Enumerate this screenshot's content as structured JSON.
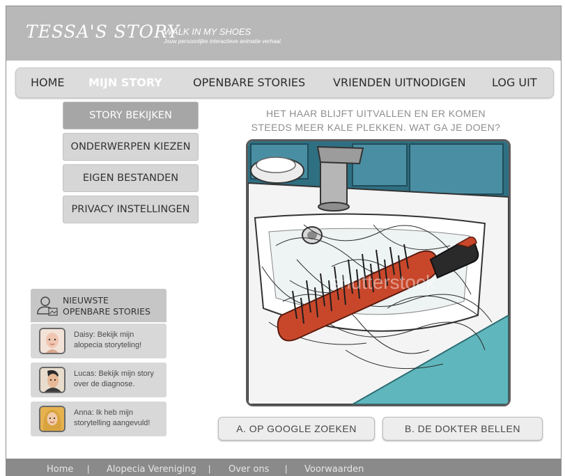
{
  "header": {
    "title": "TESSA'S STORY",
    "tagline": "WALK IN MY SHOES",
    "subtitle": "Jouw persoonlijke interactieve animatie verhaal."
  },
  "nav": {
    "items": [
      {
        "label": "HOME"
      },
      {
        "label": "MIJN STORY",
        "active": true
      },
      {
        "label": "OPENBARE STORIES"
      },
      {
        "label": "VRIENDEN UITNODIGEN"
      },
      {
        "label": "LOG UIT"
      }
    ]
  },
  "submenu": {
    "items": [
      {
        "label": "STORY BEKIJKEN",
        "active": true
      },
      {
        "label": "ONDERWERPEN KIEZEN"
      },
      {
        "label": "EIGEN BESTANDEN"
      },
      {
        "label": "PRIVACY INSTELLINGEN"
      }
    ]
  },
  "scene": {
    "question_line1": "HET HAAR BLIJFT UITVALLEN EN ER KOMEN",
    "question_line2": "STEEDS MEER KALE PLEKKEN. WAT GA JE DOEN?",
    "watermark": "shutterstock",
    "choice_a": "A. OP GOOGLE ZOEKEN",
    "choice_b": "B. DE DOKTER BELLEN"
  },
  "stories": {
    "heading_line1": "NIEUWSTE",
    "heading_line2": "OPENBARE STORIES",
    "items": [
      {
        "line1": "Daisy: Bekijk mijn",
        "line2": "alopecia storyteling!"
      },
      {
        "line1": "Lucas: Bekijk mijn story",
        "line2": "over de diagnose."
      },
      {
        "line1": "Anna: Ik heb mijn",
        "line2": "storytelling aangevuld!"
      }
    ]
  },
  "footer": {
    "links": [
      "Home",
      "Alopecia Vereniging",
      "Over ons",
      "Voorwaarden"
    ],
    "separator": "|"
  },
  "colors": {
    "header_bg": "#b8b8b8",
    "nav_bg": "#dcdcdc",
    "active_submenu": "#a6a6a6",
    "tile_blue": "#3f7f92",
    "brush_red": "#c8472b",
    "footer_bg": "#8a8a8a"
  }
}
